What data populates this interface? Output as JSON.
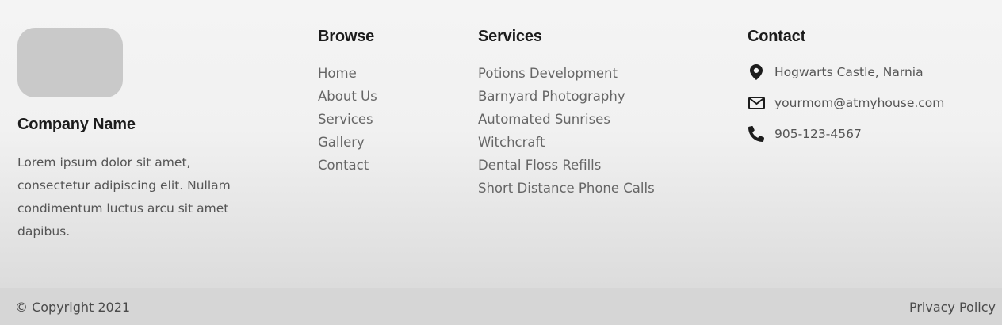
{
  "company": {
    "name": "Company Name",
    "description": "Lorem ipsum dolor sit amet, consectetur adipiscing elit. Nullam condimentum luctus arcu sit amet dapibus."
  },
  "browse": {
    "title": "Browse",
    "links": [
      "Home",
      "About Us",
      "Services",
      "Gallery",
      "Contact"
    ]
  },
  "services": {
    "title": "Services",
    "links": [
      "Potions Development",
      "Barnyard Photography",
      "Automated Sunrises",
      "Witchcraft",
      "Dental Floss Refills",
      "Short Distance Phone Calls"
    ]
  },
  "contact": {
    "title": "Contact",
    "address": "Hogwarts Castle, Narnia",
    "email": "yourmom@atmyhouse.com",
    "phone": "905-123-4567",
    "icons": {
      "address": "map-pin-icon",
      "email": "envelope-icon",
      "phone": "phone-icon"
    }
  },
  "bottom": {
    "copyright": "© Copyright 2021",
    "privacy": "Privacy Policy"
  },
  "colors": {
    "heading": "#1c1c1c",
    "text": "#555555",
    "link": "#666666",
    "logo_placeholder": "#c9c9c9",
    "bottom_bar": "#d6d6d6"
  }
}
